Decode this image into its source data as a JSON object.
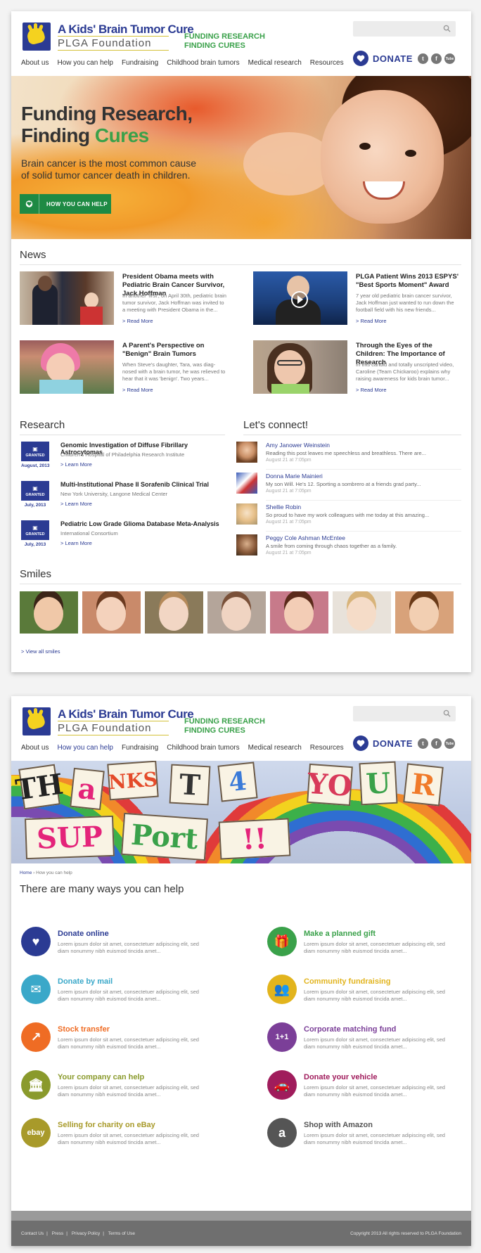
{
  "header": {
    "logo_title": "A Kids' Brain Tumor Cure",
    "logo_subtitle": "PLGA Foundation",
    "tagline_line1": "FUNDING RESEARCH",
    "tagline_line2": "FINDING CURES",
    "donate_label": "DONATE",
    "social": [
      "t",
      "f",
      "Tube"
    ],
    "nav": [
      "About us",
      "How you can help",
      "Fundraising",
      "Childhood brain tumors",
      "Medical research",
      "Resources"
    ]
  },
  "hero": {
    "title_line1": "Funding Research,",
    "title_line2_prefix": "Finding ",
    "title_line2_accent": "Cures",
    "text": "Brain cancer is the most common cause of solid tumor cancer death in children.",
    "button_label": "HOW YOU CAN HELP"
  },
  "news": {
    "title": "News",
    "items": [
      {
        "headline": "President Obama meets with Pediatric Brain Cancer Survivor, Jack Hoffman",
        "excerpt": "In another 'first', on April 30th, pediatric brain tumor survivor, Jack Hoffman was invited to a meeting with President Obama in the...",
        "more": "> Read More"
      },
      {
        "headline": "PLGA Patient Wins 2013 ESPYS' \"Best Sports Moment\" Award",
        "excerpt": "7 year old pediatric brain cancer survivor, Jack Hoffman just wanted to run down the football field with his new friends...",
        "more": "> Read More"
      },
      {
        "headline": "A Parent's Perspective on \"Benign\" Brain Tumors",
        "excerpt": "When Steve's daughter, Tara, was diag-nosed with a brain tumor, he was relieved to hear that it was 'benign'. Two years...",
        "more": "> Read More"
      },
      {
        "headline": "Through the Eyes of the Children: The Importance of Research",
        "excerpt": "In this candid and totally unscripted video, Caroline (Team Chickaroo) explains why raising awareness for kids brain tumor...",
        "more": "> Read More"
      }
    ]
  },
  "research": {
    "title": "Research",
    "granted_label": "GRANTED",
    "items": [
      {
        "date": "August, 2013",
        "title": "Genomic Investigation of Diffuse Fibrillary Astrocytomas",
        "institution": "Children's Hospital of Philadelphia Research Institute",
        "more": "> Learn More"
      },
      {
        "date": "July, 2013",
        "title": "Multi-Institutional Phase II Sorafenib Clinical Trial",
        "institution": "New York University, Langone Medical Center",
        "more": "> Learn More"
      },
      {
        "date": "July, 2013",
        "title": "Pediatric Low Grade Glioma Database Meta-Analysis",
        "institution": "International Consortium",
        "more": "> Learn More"
      }
    ]
  },
  "connect": {
    "title": "Let's connect!",
    "items": [
      {
        "name": "Amy Janower Weinstein",
        "text": "Reading this post leaves me speechless and breathless. There are...",
        "time": "August 21 at 7:05pm"
      },
      {
        "name": "Donna Marie Mainieri",
        "text": "My son Will. He's 12. Sporting a sombrero at a friends grad party...",
        "time": "August 21 at 7:05pm"
      },
      {
        "name": "Shellie Robin",
        "text": "So proud to have my work colleagues with me today at this amazing...",
        "time": "August 21 at 7:05pm"
      },
      {
        "name": "Peggy Cole Ashman McEntee",
        "text": "A smile from coming through chaos together as a family.",
        "time": "August 21 at 7:05pm"
      }
    ]
  },
  "smiles": {
    "title": "Smiles",
    "view_all": "> View all smiles"
  },
  "page2": {
    "nav_active_index": 1,
    "breadcrumb_home": "Home",
    "breadcrumb_current": " › How you can help",
    "title": "There are many ways you can help",
    "ways": [
      {
        "title": "Donate online",
        "color": "#2b3b93",
        "icon": "heart-icon",
        "glyph": "♥",
        "desc": "Lorem ipsum dolor sit amet, consectetuer adipiscing elit, sed diam nonummy nibh euismod tincida amet..."
      },
      {
        "title": "Make a planned gift",
        "color": "#3aa14a",
        "icon": "gift-icon",
        "glyph": "🎁",
        "desc": "Lorem ipsum dolor sit amet, consectetuer adipiscing elit, sed diam nonummy nibh euismod tincida amet..."
      },
      {
        "title": "Donate by mail",
        "color": "#3aa8c9",
        "icon": "mail-heart-icon",
        "glyph": "✉",
        "desc": "Lorem ipsum dolor sit amet, consectetuer adipiscing elit, sed diam nonummy nibh euismod tincida amet..."
      },
      {
        "title": "Community fundraising",
        "color": "#e2b41d",
        "icon": "people-icon",
        "glyph": "👥",
        "desc": "Lorem ipsum dolor sit amet, consectetuer adipiscing elit, sed diam nonummy nibh euismod tincida amet..."
      },
      {
        "title": "Stock transfer",
        "color": "#ef6c24",
        "icon": "chart-up-icon",
        "glyph": "↗",
        "desc": "Lorem ipsum dolor sit amet, consectetuer adipiscing elit, sed diam nonummy nibh euismod tincida amet..."
      },
      {
        "title": "Corporate matching fund",
        "color": "#7b3f98",
        "icon": "one-plus-one-icon",
        "glyph": "1+1",
        "desc": "Lorem ipsum dolor sit amet, consectetuer adipiscing elit, sed diam nonummy nibh euismod tincida amet..."
      },
      {
        "title": "Your company can help",
        "color": "#8a9a2c",
        "icon": "building-icon",
        "glyph": "🏛",
        "desc": "Lorem ipsum dolor sit amet, consectetuer adipiscing elit, sed diam nonummy nibh euismod tincida amet..."
      },
      {
        "title": "Donate your vehicle",
        "color": "#a01c5c",
        "icon": "car-icon",
        "glyph": "🚗",
        "desc": "Lorem ipsum dolor sit amet, consectetuer adipiscing elit, sed diam nonummy nibh euismod tincida amet..."
      },
      {
        "title": "Selling for charity on eBay",
        "color": "#a89a2a",
        "icon": "ebay-icon",
        "glyph": "ebay",
        "desc": "Lorem ipsum dolor sit amet, consectetuer adipiscing elit, sed diam nonummy nibh euismod tincida amet..."
      },
      {
        "title": "Shop with Amazon",
        "color": "#555555",
        "icon": "amazon-icon",
        "glyph": "a",
        "desc": "Lorem ipsum dolor sit amet, consectetuer adipiscing elit, sed diam nonummy nibh euismod tincida amet..."
      }
    ]
  },
  "footer": {
    "links": [
      "Contact Us",
      "Press",
      "Privacy Policy",
      "Terms of Use"
    ],
    "copyright": "Copyright 2013 All rights reserved to PLGA Foundation"
  },
  "colors": {
    "brand_blue": "#2b3b93",
    "brand_green": "#3aa14a",
    "accent_yellow": "#f4d21f"
  }
}
